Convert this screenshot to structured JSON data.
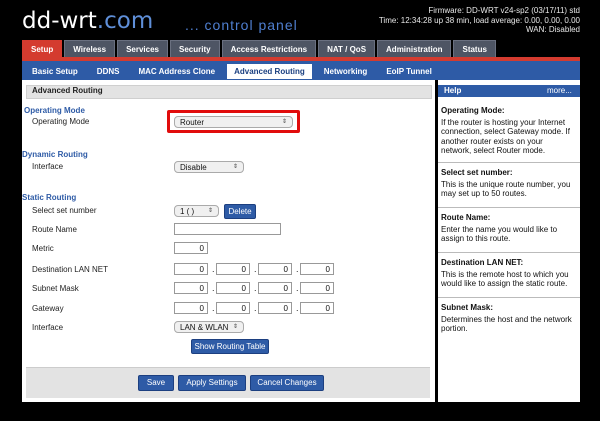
{
  "header": {
    "logo_main": "dd-wrt",
    "logo_suffix": ".com",
    "subtitle": "... control panel",
    "firmware": "Firmware: DD-WRT v24-sp2 (03/17/11) std",
    "time": "Time: 12:34:28 up 38 min, load average: 0.00, 0.00, 0.00",
    "wan": "WAN: Disabled"
  },
  "main_tabs": [
    {
      "label": "Setup",
      "active": true
    },
    {
      "label": "Wireless"
    },
    {
      "label": "Services"
    },
    {
      "label": "Security"
    },
    {
      "label": "Access Restrictions"
    },
    {
      "label": "NAT / QoS"
    },
    {
      "label": "Administration"
    },
    {
      "label": "Status"
    }
  ],
  "sub_tabs": [
    {
      "label": "Basic Setup"
    },
    {
      "label": "DDNS"
    },
    {
      "label": "MAC Address Clone"
    },
    {
      "label": "Advanced Routing",
      "active": true
    },
    {
      "label": "Networking"
    },
    {
      "label": "EoIP Tunnel"
    }
  ],
  "panel_title": "Advanced Routing",
  "operating_mode": {
    "legend": "Operating Mode",
    "label": "Operating Mode",
    "value": "Router"
  },
  "dynamic_routing": {
    "legend": "Dynamic Routing",
    "interface_label": "Interface",
    "interface_value": "Disable"
  },
  "static_routing": {
    "legend": "Static Routing",
    "set_number_label": "Select set number",
    "set_number_value": "1 ( )",
    "delete_label": "Delete",
    "route_name_label": "Route Name",
    "route_name_value": "",
    "metric_label": "Metric",
    "metric_value": "0",
    "dest_label": "Destination LAN NET",
    "dest": [
      "0",
      "0",
      "0",
      "0"
    ],
    "subnet_label": "Subnet Mask",
    "subnet": [
      "0",
      "0",
      "0",
      "0"
    ],
    "gateway_label": "Gateway",
    "gateway": [
      "0",
      "0",
      "0",
      "0"
    ],
    "interface_label": "Interface",
    "interface_value": "LAN & WLAN",
    "show_table_label": "Show Routing Table"
  },
  "footer": {
    "save": "Save",
    "apply": "Apply Settings",
    "cancel": "Cancel Changes"
  },
  "help": {
    "title": "Help",
    "more": "more...",
    "sections": [
      {
        "title": "Operating Mode:",
        "text": "If the router is hosting your Internet connection, select Gateway mode. If another router exists on your network, select Router mode."
      },
      {
        "title": "Select set number:",
        "text": "This is the unique route number, you may set up to 50 routes."
      },
      {
        "title": "Route Name:",
        "text": "Enter the name you would like to assign to this route."
      },
      {
        "title": "Destination LAN NET:",
        "text": "This is the remote host to which you would like to assign the static route."
      },
      {
        "title": "Subnet Mask:",
        "text": "Determines the host and the network portion."
      }
    ]
  },
  "colors": {
    "accent_red": "#d43b2f",
    "accent_blue": "#2e5ba6",
    "highlight": "#e10c0c"
  }
}
